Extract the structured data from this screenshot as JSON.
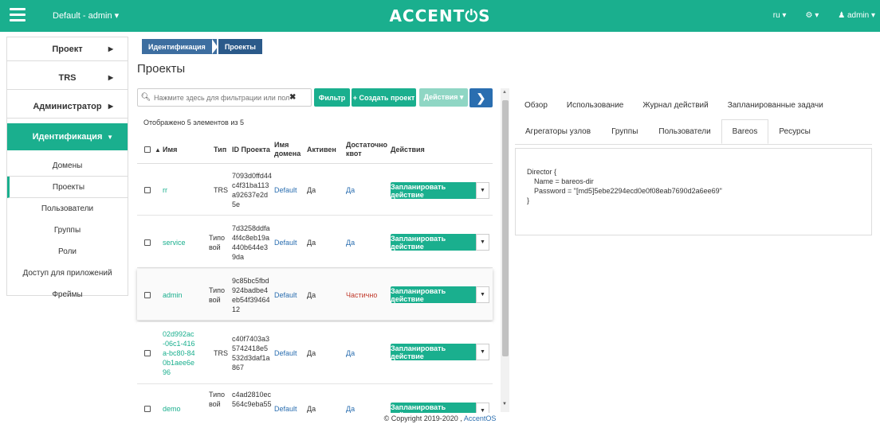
{
  "topbar": {
    "project_select": "Default - admin ▾",
    "logo": "ACCENT⏻S",
    "lang": "ru ▾",
    "settings": "⚙ ▾",
    "user": "♟ admin ▾"
  },
  "sidebar": {
    "items": [
      {
        "label": "Проект"
      },
      {
        "label": "TRS"
      },
      {
        "label": "Администратор"
      },
      {
        "label": "Идентификация"
      }
    ],
    "subitems": [
      {
        "label": "Домены"
      },
      {
        "label": "Проекты"
      },
      {
        "label": "Пользователи"
      },
      {
        "label": "Группы"
      },
      {
        "label": "Роли"
      },
      {
        "label": "Доступ для приложений"
      },
      {
        "label": "Фреймы"
      }
    ]
  },
  "breadcrumb": [
    "Идентификация",
    "Проекты"
  ],
  "page_title": "Проекты",
  "toolbar": {
    "search_placeholder": "Нажмите здесь для фильтрации или полнот...",
    "filter_label": "Фильтр",
    "create_label": "+ Создать проект",
    "actions_label": "Действия ▾"
  },
  "count_text": "Отображено 5 элементов из 5",
  "table": {
    "headers": {
      "name": "Имя",
      "type": "Тип",
      "id": "ID Проекта",
      "domain": "Имя домена",
      "active": "Активен",
      "quota": "Достаточно квот",
      "actions": "Действия"
    },
    "rows": [
      {
        "name": "rr",
        "type": "TRS",
        "id": "7093d0ffd44c4f31ba113a92637e2d5e",
        "domain": "Default",
        "active": "Да",
        "quota": "Да",
        "action": "Запланировать действие"
      },
      {
        "name": "service",
        "type": "Типовой",
        "id": "7d3258ddfa4f4c8eb19a440b644e39da",
        "domain": "Default",
        "active": "Да",
        "quota": "Да",
        "action": "Запланировать действие"
      },
      {
        "name": "admin",
        "type": "Типовой",
        "id": "9c85bc5fbd924badbe4eb54f3946412",
        "domain": "Default",
        "active": "Да",
        "quota": "Частично",
        "action": "Запланировать действие"
      },
      {
        "name": "02d992ac-06c1-416a-bc80-840b1aee6e96",
        "type": "TRS",
        "id": "c40f7403a35742418e5532d3daf1a867",
        "domain": "Default",
        "active": "Да",
        "quota": "Да",
        "action": "Запланировать действие"
      },
      {
        "name": "demo",
        "type": "Типовой",
        "id": "c4ad2810ec564c9eba55",
        "domain": "Default",
        "active": "Да",
        "quota": "Да",
        "action": "Запланировать действие"
      }
    ]
  },
  "detail": {
    "tabs_row1": [
      "Обзор",
      "Использование",
      "Журнал действий",
      "Запланированные задачи"
    ],
    "tabs_row2": [
      "Агрегаторы узлов",
      "Группы",
      "Пользователи",
      "Bareos",
      "Ресурсы"
    ],
    "active_tab": "Bareos",
    "config": {
      "line1": "Director {",
      "line2": "Name = bareos-dir",
      "line3": "Password = \"[md5]5ebe2294ecd0e0f08eab7690d2a6ee69\"",
      "line4": "}"
    }
  },
  "footer": {
    "copyright": "© Copyright 2019-2020 ,",
    "brand": "AccentOS"
  },
  "colors": {
    "accent": "#1aaf8e",
    "breadcrumb": "#3d6ea0",
    "link": "#2a6eb0",
    "warning": "#c0392b"
  }
}
